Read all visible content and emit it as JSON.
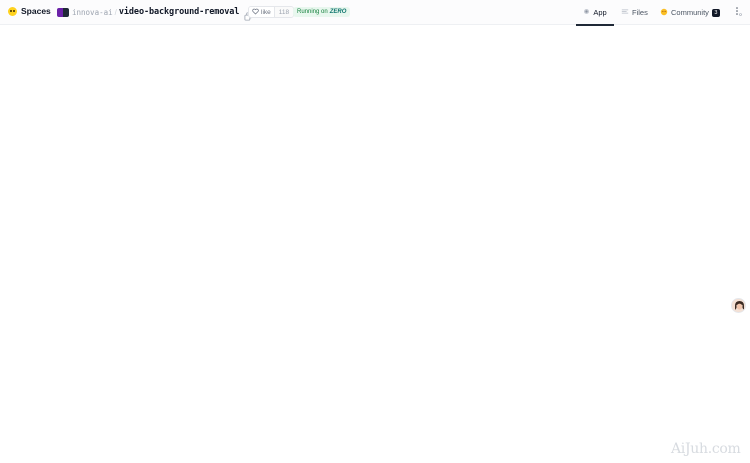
{
  "brand": {
    "label": "Spaces",
    "icon": "huggingface-logo-icon"
  },
  "repo": {
    "org": "innova-ai",
    "separator": "/",
    "name": "video-background-removal"
  },
  "likes": {
    "label": "like",
    "count": "118"
  },
  "status": {
    "prefix": "Running on",
    "hardware": "ZERO"
  },
  "tabs": [
    {
      "label": "App",
      "icon": "app-icon",
      "active": true
    },
    {
      "label": "Files",
      "icon": "files-icon",
      "active": false
    },
    {
      "label": "Community",
      "icon": "community-icon",
      "badge": "3",
      "active": false
    }
  ],
  "watermark": "AiJuh.com",
  "colors": {
    "accent": "#1f2937",
    "status_bg": "#e8f7ee",
    "status_text": "#15803d",
    "brand_yellow": "#ffd21e"
  }
}
